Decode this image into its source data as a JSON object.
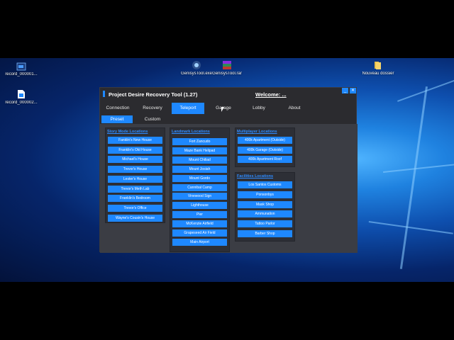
{
  "desktop": {
    "icons": [
      {
        "label": "record_000001...",
        "icon": "video-file-icon"
      },
      {
        "label": "record_000002...",
        "icon": "document-file-icon"
      },
      {
        "label": "GenisysTool.exe",
        "icon": "app-exe-icon"
      },
      {
        "label": "GenisysTool.rar",
        "icon": "rar-archive-icon"
      },
      {
        "label": "Nouveau dossier",
        "icon": "folder-icon"
      }
    ]
  },
  "window": {
    "title": "Project Desire Recovery Tool (1.27)",
    "welcome": "Welcome: ...",
    "minimize": "_",
    "close": "✕",
    "tabs": [
      "Connection",
      "Recovery",
      "Teleport",
      "Garage",
      "Lobby",
      "About"
    ],
    "active_tab": "Teleport",
    "subtabs": [
      "Preset",
      "Custom"
    ],
    "active_subtab": "Preset",
    "accent_color": "#1e88ff",
    "groups": {
      "story": {
        "title": "Story Mode Locations",
        "items": [
          "Fanklin's New House",
          "Franklin's Old House",
          "Michael's House",
          "Trevor's House",
          "Lester's House",
          "Trevor's Meth Lab",
          "Franklin's Bedroom",
          "Trevor's Office",
          "Wayne's Cousin's House"
        ]
      },
      "landmark": {
        "title": "Landmark Locations",
        "items": [
          "Fort Zancudo",
          "Maze Bank Helipad",
          "Mount Chiliad",
          "Mount Josiah",
          "Mount Gordo",
          "Cannibal Camp",
          "Vinewood Sign",
          "Lighthouse",
          "Pier",
          "McKenzie Airfield",
          "Grapeseed Air Field",
          "Main Airport"
        ]
      },
      "multiplayer": {
        "title": "Multiplayer Locations",
        "items": [
          "400k Apartment (Outside)",
          "400k Garage (Outside)",
          "400k Apartment Roof"
        ]
      },
      "facilities": {
        "title": "Facilities Locations",
        "items": [
          "Los Santos Customs",
          "Ponsonbys",
          "Mask Shop",
          "Ammunation",
          "Tattoo Parlor",
          "Barber Shop"
        ]
      }
    }
  }
}
